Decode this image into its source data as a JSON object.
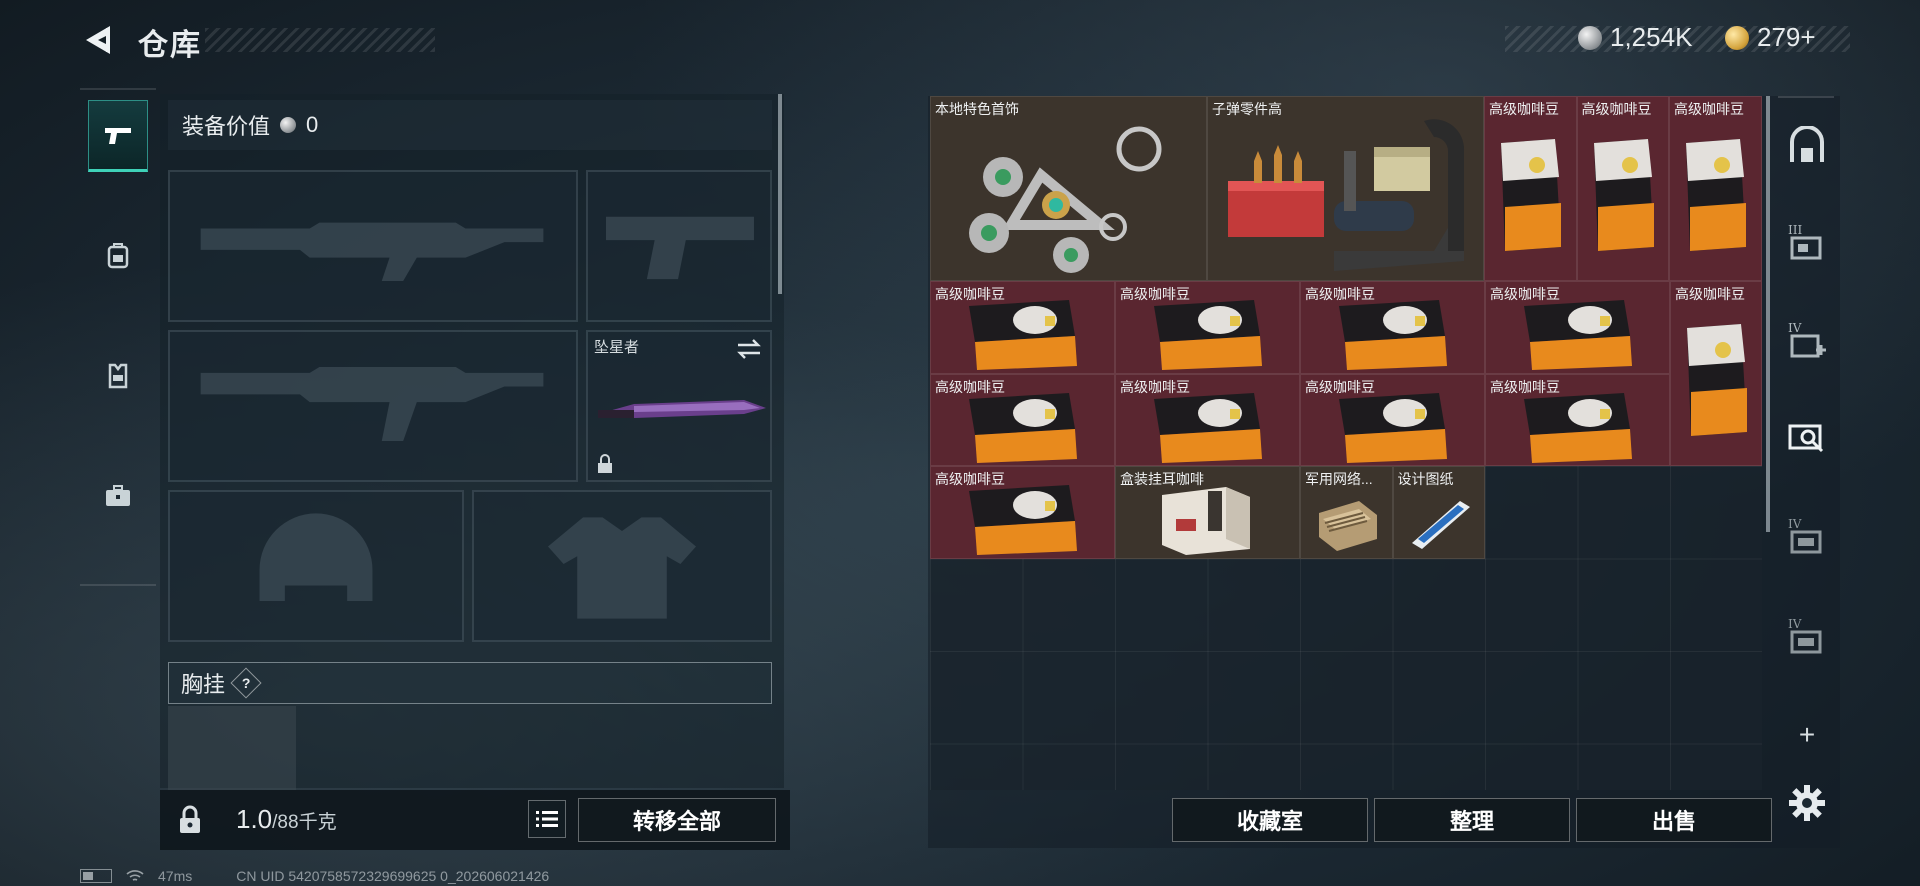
{
  "header": {
    "title": "仓库",
    "currencies": [
      {
        "icon": "silver-coin-icon",
        "value": "1,254K"
      },
      {
        "icon": "gold-coin-icon",
        "value": "279+"
      }
    ]
  },
  "left_tabs": [
    {
      "icon": "pistol-icon",
      "active": true
    },
    {
      "icon": "backpack-icon",
      "active": false
    },
    {
      "icon": "vest-icon",
      "active": false
    },
    {
      "icon": "briefcase-icon",
      "active": false
    }
  ],
  "equipment": {
    "value_label": "装备价值",
    "value": "0",
    "melee_label": "坠星者",
    "rig_label": "胸挂",
    "help_icon": "?"
  },
  "bottom_left": {
    "weight_value": "1.0",
    "weight_max": "/88千克",
    "transfer_all": "转移全部"
  },
  "inventory": {
    "items": [
      {
        "label": "本地特色首饰",
        "icon": "jewelry-icon"
      },
      {
        "label": "子弹零件高",
        "icon": "ammo-parts-icon"
      },
      {
        "label": "高级咖啡豆",
        "icon": "coffee-bag-icon"
      },
      {
        "label": "高级咖啡豆",
        "icon": "coffee-bag-icon"
      },
      {
        "label": "高级咖啡豆",
        "icon": "coffee-bag-icon"
      },
      {
        "label": "高级咖啡豆",
        "icon": "coffee-box-icon"
      },
      {
        "label": "高级咖啡豆",
        "icon": "coffee-box-icon"
      },
      {
        "label": "高级咖啡豆",
        "icon": "coffee-box-icon"
      },
      {
        "label": "高级咖啡豆",
        "icon": "coffee-box-icon"
      },
      {
        "label": "高级咖啡豆",
        "icon": "coffee-bag-icon"
      },
      {
        "label": "高级咖啡豆",
        "icon": "coffee-box-icon"
      },
      {
        "label": "高级咖啡豆",
        "icon": "coffee-box-icon"
      },
      {
        "label": "高级咖啡豆",
        "icon": "coffee-box-icon"
      },
      {
        "label": "高级咖啡豆",
        "icon": "coffee-box-icon"
      },
      {
        "label": "高级咖啡豆",
        "icon": "coffee-box-icon"
      },
      {
        "label": "盒装挂耳咖啡",
        "icon": "drip-coffee-box-icon"
      },
      {
        "label": "军用网络...",
        "icon": "network-module-icon"
      },
      {
        "label": "设计图纸",
        "icon": "blueprint-icon"
      }
    ]
  },
  "bottom_right": {
    "collection": "收藏室",
    "organize": "整理",
    "sell": "出售"
  },
  "right_tabs": [
    {
      "icon": "safe-house-icon",
      "label": ""
    },
    {
      "icon": "storage-iii-icon",
      "label": "III"
    },
    {
      "icon": "storage-iv-add-icon",
      "label": "IV"
    },
    {
      "icon": "storage-search-icon",
      "label": ""
    },
    {
      "icon": "storage-iv-icon",
      "label": "IV"
    },
    {
      "icon": "storage-iv-icon",
      "label": "IV"
    },
    {
      "icon": "add-icon",
      "label": "+"
    },
    {
      "icon": "settings-icon",
      "label": ""
    }
  ],
  "status": {
    "ping": "47ms",
    "uid": "CN UID 5420758572329699625 0_202606021426"
  },
  "colors": {
    "accent": "#3fd2b8",
    "item_red": "#5a2630",
    "item_brown": "#3c342c"
  }
}
